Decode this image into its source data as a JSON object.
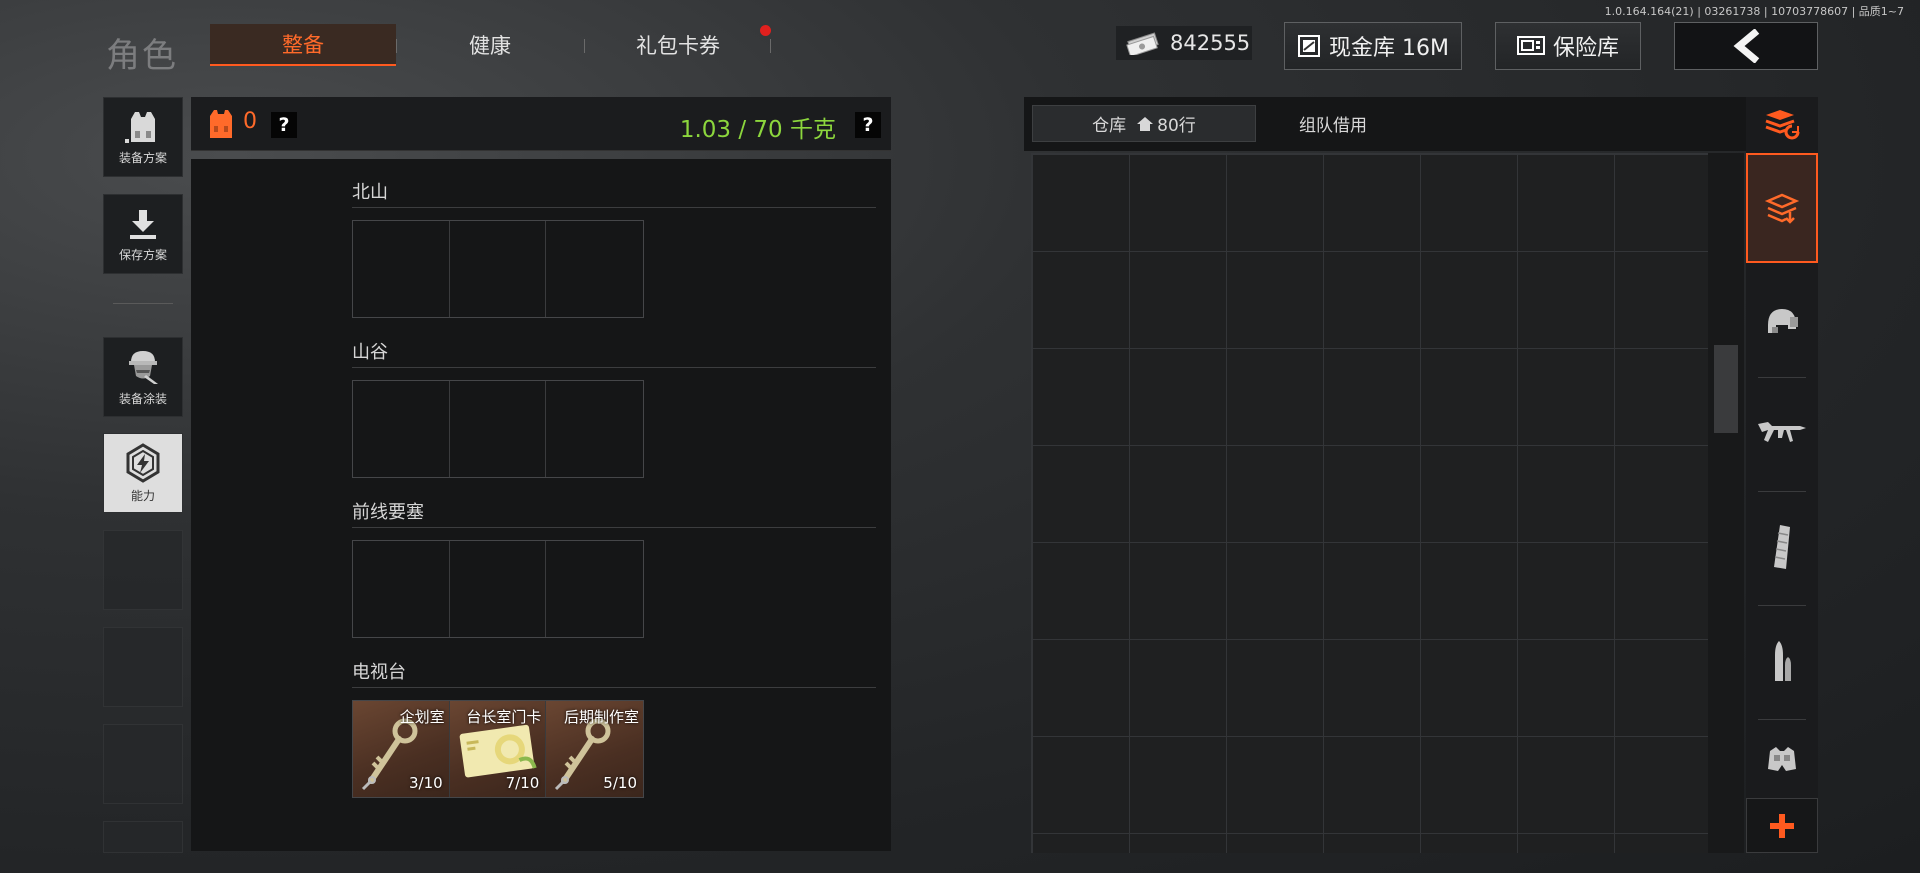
{
  "version_info": "1.0.164.164(21) | 03261738 | 10703778607 | 品质1~7",
  "header": {
    "title": "角色",
    "tabs": [
      {
        "label": "整备",
        "active": true
      },
      {
        "label": "健康",
        "active": false
      },
      {
        "label": "礼包卡券",
        "active": false,
        "badge": true
      }
    ],
    "currency": "842555",
    "cash_vault_label": "现金库 16M",
    "safe_label": "保险库"
  },
  "sidebar": {
    "items": [
      {
        "label": "装备方案",
        "icon": "vest-icon"
      },
      {
        "label": "保存方案",
        "icon": "download-icon"
      },
      {
        "label": "装备涂装",
        "icon": "soldier-icon"
      },
      {
        "label": "能力",
        "icon": "power-icon"
      }
    ]
  },
  "loadout": {
    "vest_count": "0",
    "help": "?",
    "weight": "1.03 / 70 千克",
    "sections": [
      {
        "title": "北山",
        "items": []
      },
      {
        "title": "山谷",
        "items": []
      },
      {
        "title": "前线要塞",
        "items": []
      },
      {
        "title": "电视台",
        "items": [
          {
            "name": "企划室",
            "count": "3/10",
            "icon": "key-icon"
          },
          {
            "name": "台长室门卡",
            "count": "7/10",
            "icon": "keycard-icon"
          },
          {
            "name": "后期制作室",
            "count": "5/10",
            "icon": "key-icon"
          }
        ]
      }
    ]
  },
  "warehouse": {
    "tabs": [
      {
        "label": "仓库",
        "rows": "80行",
        "active": true
      },
      {
        "label": "组队借用",
        "active": false
      }
    ]
  },
  "categories": [
    "layers-refresh-icon",
    "layers-active-icon",
    "helmet-icon",
    "rifle-icon",
    "magazine-icon",
    "ammo-icon",
    "armor-icon"
  ],
  "colors": {
    "accent": "#ff5a1f",
    "weight_green": "#8cd63d",
    "badge_red": "#e0201e",
    "item_brown": "#5a3b2a"
  }
}
